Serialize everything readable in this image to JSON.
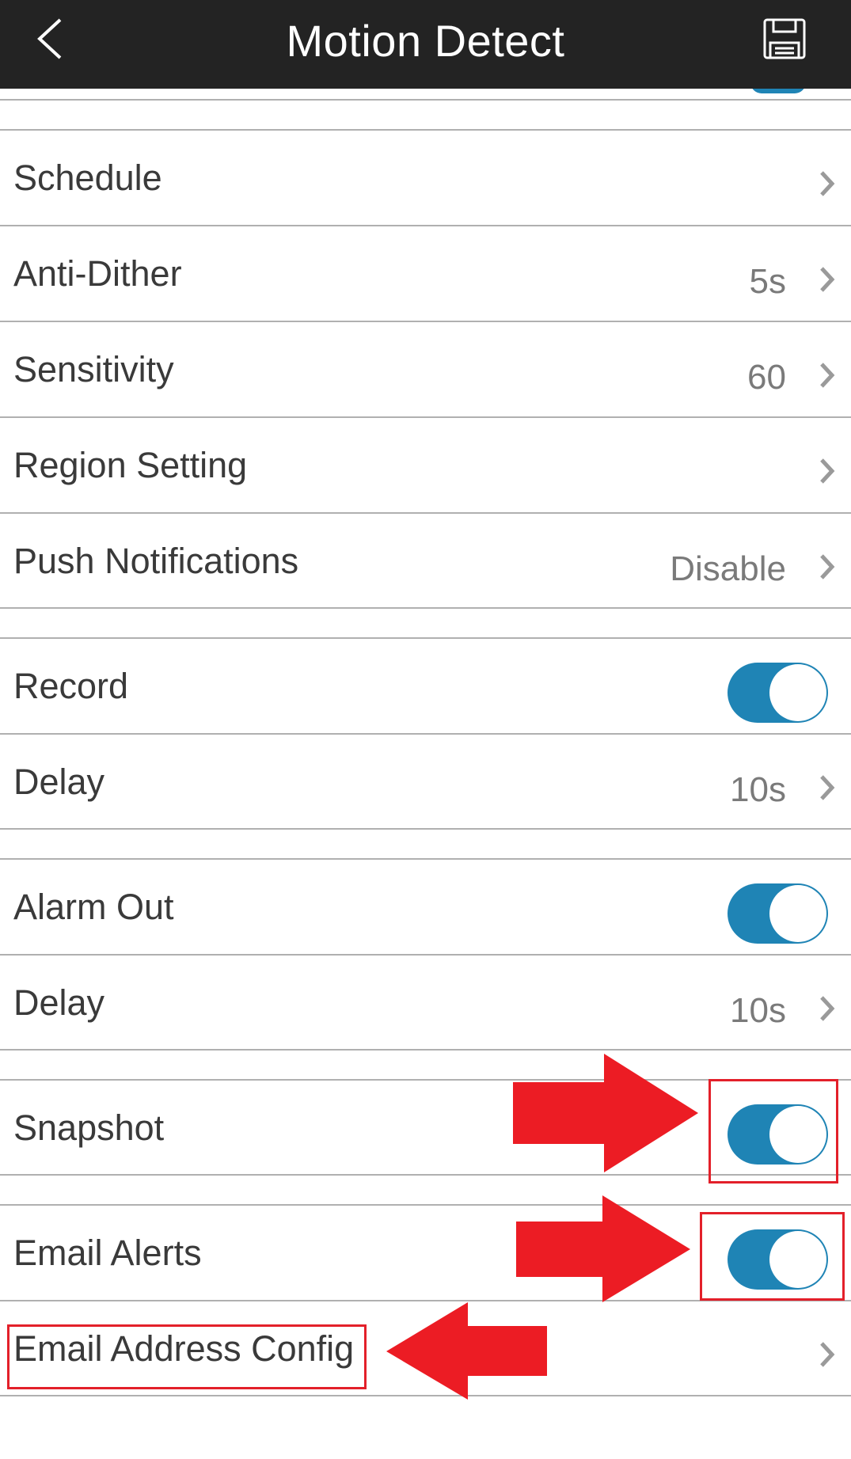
{
  "header": {
    "title": "Motion Detect",
    "back_icon": "chevron-left-icon",
    "save_icon": "floppy-disk-save-icon"
  },
  "settings": {
    "schedule": {
      "label": "Schedule",
      "value": ""
    },
    "anti_dither": {
      "label": "Anti-Dither",
      "value": "5s"
    },
    "sensitivity": {
      "label": "Sensitivity",
      "value": "60"
    },
    "region_setting": {
      "label": "Region Setting",
      "value": ""
    },
    "push_notifications": {
      "label": "Push Notifications",
      "value": "Disable"
    },
    "record": {
      "label": "Record",
      "enabled": true
    },
    "record_delay": {
      "label": "Delay",
      "value": "10s"
    },
    "alarm_out": {
      "label": "Alarm Out",
      "enabled": true
    },
    "alarm_out_delay": {
      "label": "Delay",
      "value": "10s"
    },
    "snapshot": {
      "label": "Snapshot",
      "enabled": true
    },
    "email_alerts": {
      "label": "Email Alerts",
      "enabled": true
    },
    "email_address_config": {
      "label": "Email Address Config",
      "value": ""
    }
  },
  "colors": {
    "header_bg": "#232323",
    "toggle_on": "#1f84b5",
    "annotation_red": "#e3202a",
    "label_text": "#3a3a3a",
    "value_text": "#7a7a7a"
  },
  "annotations": [
    {
      "type": "arrow-right",
      "target": "snapshot-toggle"
    },
    {
      "type": "highlight-box",
      "target": "snapshot-toggle"
    },
    {
      "type": "arrow-right",
      "target": "email-alerts-toggle"
    },
    {
      "type": "highlight-box",
      "target": "email-alerts-toggle"
    },
    {
      "type": "arrow-left",
      "target": "email-address-config"
    },
    {
      "type": "highlight-box",
      "target": "email-address-config"
    }
  ]
}
